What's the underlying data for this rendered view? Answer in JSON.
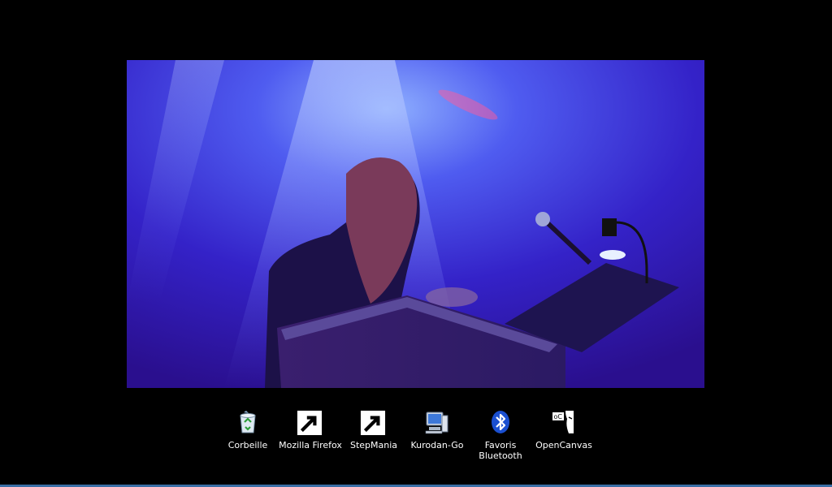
{
  "desktop": {
    "background_color": "#000000",
    "wallpaper": {
      "accent_color": "#3b2be0"
    },
    "icons": [
      {
        "label": "Corbeille",
        "icon": "recycle-bin-icon",
        "shortcut": false
      },
      {
        "label": "Mozilla Firefox",
        "icon": "firefox-icon",
        "shortcut": true
      },
      {
        "label": "StepMania",
        "icon": "stepmania-icon",
        "shortcut": true
      },
      {
        "label": "Kurodan-Go",
        "icon": "computer-icon",
        "shortcut": false
      },
      {
        "label": "Favoris Bluetooth",
        "icon": "bluetooth-icon",
        "shortcut": false
      },
      {
        "label": "OpenCanvas",
        "icon": "opencanvas-icon",
        "shortcut": false
      }
    ]
  },
  "taskbar": {
    "color": "#3a6ea5"
  }
}
